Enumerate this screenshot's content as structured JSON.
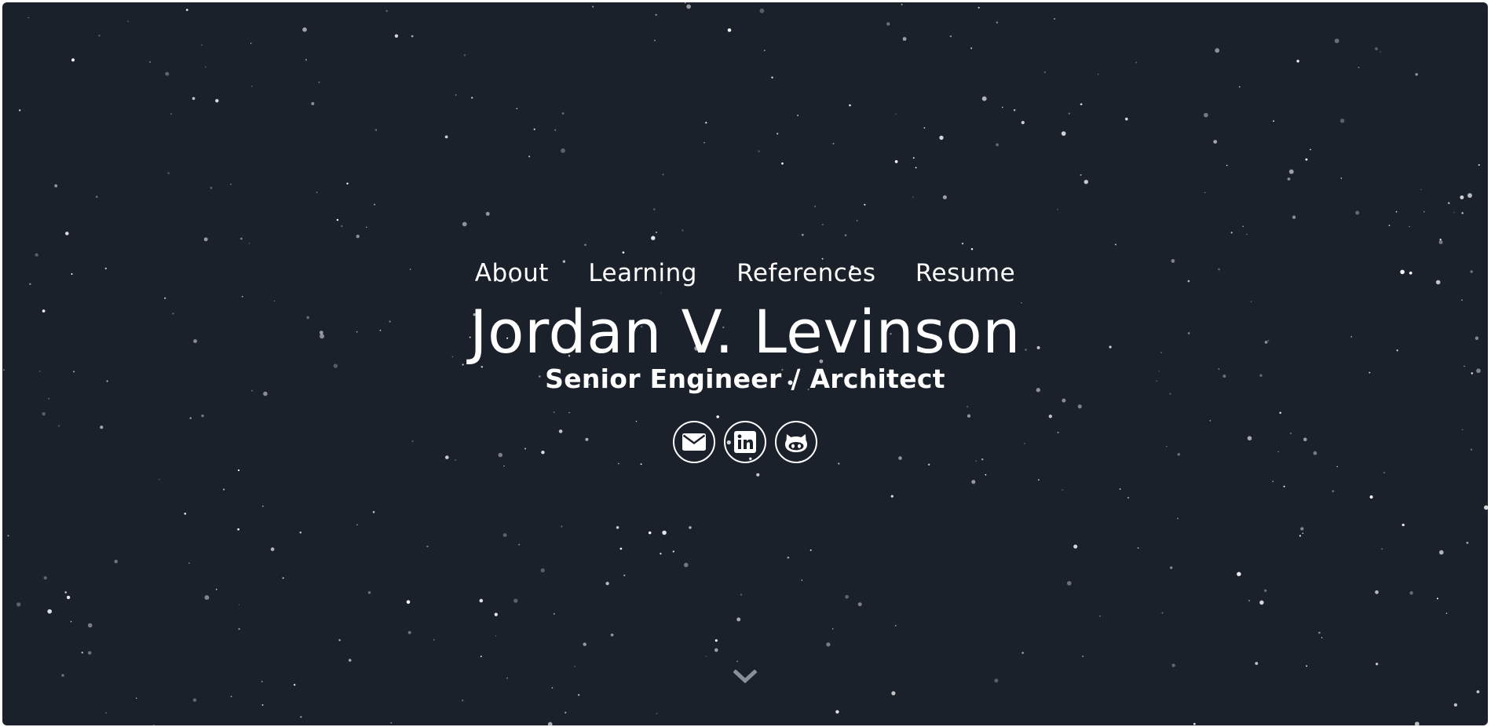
{
  "nav": {
    "items": [
      {
        "label": "About"
      },
      {
        "label": "Learning"
      },
      {
        "label": "References"
      },
      {
        "label": "Resume"
      }
    ]
  },
  "hero": {
    "name": "Jordan V. Levinson",
    "title": "Senior Engineer / Architect"
  },
  "socials": [
    {
      "icon": "envelope-icon"
    },
    {
      "icon": "linkedin-icon"
    },
    {
      "icon": "github-icon"
    }
  ],
  "scroll_hint": {
    "icon": "chevron-down-icon"
  },
  "colors": {
    "background": "#1b212b",
    "text": "#ffffff",
    "star": "#ffffff",
    "chevron": "#8a9099"
  }
}
